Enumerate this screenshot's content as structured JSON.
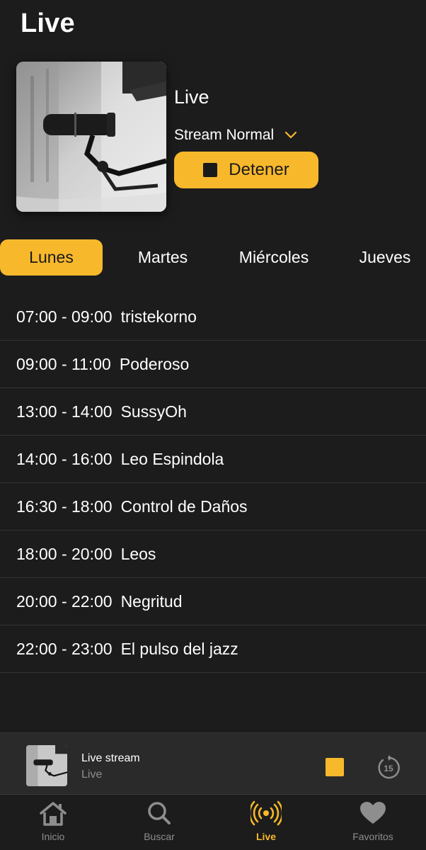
{
  "header": {
    "title": "Live"
  },
  "now_playing": {
    "station_name": "Live",
    "stream_quality": "Stream Normal",
    "stop_label": "Detener"
  },
  "days": [
    {
      "label": "Lunes",
      "active": true
    },
    {
      "label": "Martes",
      "active": false
    },
    {
      "label": "Miércoles",
      "active": false
    },
    {
      "label": "Jueves",
      "active": false
    }
  ],
  "schedule": [
    {
      "time": "07:00 - 09:00",
      "show": "tristekorno"
    },
    {
      "time": "09:00 - 11:00",
      "show": "Poderoso"
    },
    {
      "time": "13:00 - 14:00",
      "show": "SussyOh"
    },
    {
      "time": "14:00 - 16:00",
      "show": "Leo Espindola"
    },
    {
      "time": "16:30 - 18:00",
      "show": "Control de Daños"
    },
    {
      "time": "18:00 - 20:00",
      "show": "Leos"
    },
    {
      "time": "20:00 - 22:00",
      "show": "Negritud"
    },
    {
      "time": "22:00 - 23:00",
      "show": "El pulso del jazz"
    }
  ],
  "mini_player": {
    "title": "Live stream",
    "subtitle": "Live",
    "replay_seconds": "15"
  },
  "tab_bar": {
    "items": [
      {
        "label": "Inicio",
        "icon": "home-icon",
        "active": false
      },
      {
        "label": "Buscar",
        "icon": "search-icon",
        "active": false
      },
      {
        "label": "Live",
        "icon": "broadcast-icon",
        "active": true
      },
      {
        "label": "Favoritos",
        "icon": "heart-icon",
        "active": false
      }
    ]
  },
  "colors": {
    "accent": "#f8b82c",
    "background": "#1c1c1c",
    "inactive": "#8e8e8e"
  }
}
